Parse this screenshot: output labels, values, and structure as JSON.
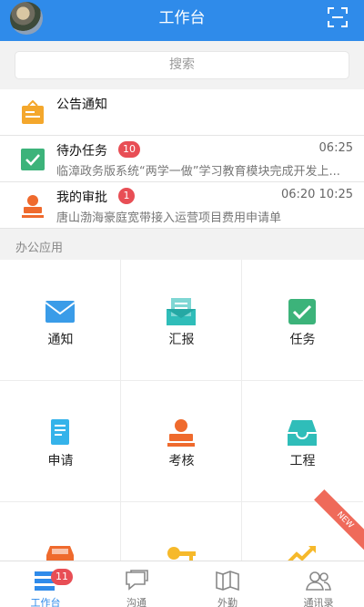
{
  "header": {
    "title": "工作台"
  },
  "search": {
    "placeholder": "搜索"
  },
  "list": [
    {
      "title": "公告通知"
    },
    {
      "title": "待办任务",
      "badge": "10",
      "time": "06:25",
      "subtitle": "临漳政务版系统“两学一做”学习教育模块完成开发上..."
    },
    {
      "title": "我的审批",
      "badge": "1",
      "time": "06:20 10:25",
      "subtitle": "唐山渤海豪庭宽带接入运营项目费用申请单"
    }
  ],
  "section": {
    "label": "办公应用"
  },
  "apps": [
    {
      "label": "通知",
      "icon": "mail-icon"
    },
    {
      "label": "汇报",
      "icon": "report-icon"
    },
    {
      "label": "任务",
      "icon": "task-check-icon"
    },
    {
      "label": "申请",
      "icon": "application-doc-icon"
    },
    {
      "label": "考核",
      "icon": "stamp-icon"
    },
    {
      "label": "工程",
      "icon": "tray-icon"
    },
    {
      "label": "",
      "icon": "car-icon"
    },
    {
      "label": "",
      "icon": "key-icon"
    },
    {
      "label": "",
      "icon": "chart-up-icon",
      "ribbon": "NEW"
    }
  ],
  "tabs": [
    {
      "label": "工作台",
      "badge": "11",
      "active": true
    },
    {
      "label": "沟通"
    },
    {
      "label": "外勤"
    },
    {
      "label": "通讯录"
    }
  ],
  "colors": {
    "primary": "#2f8bea",
    "badge": "#e84e55",
    "orange": "#f4a72c",
    "green": "#3cb37a",
    "teal": "#2fbdb9",
    "red_orange": "#ef6a2d"
  }
}
